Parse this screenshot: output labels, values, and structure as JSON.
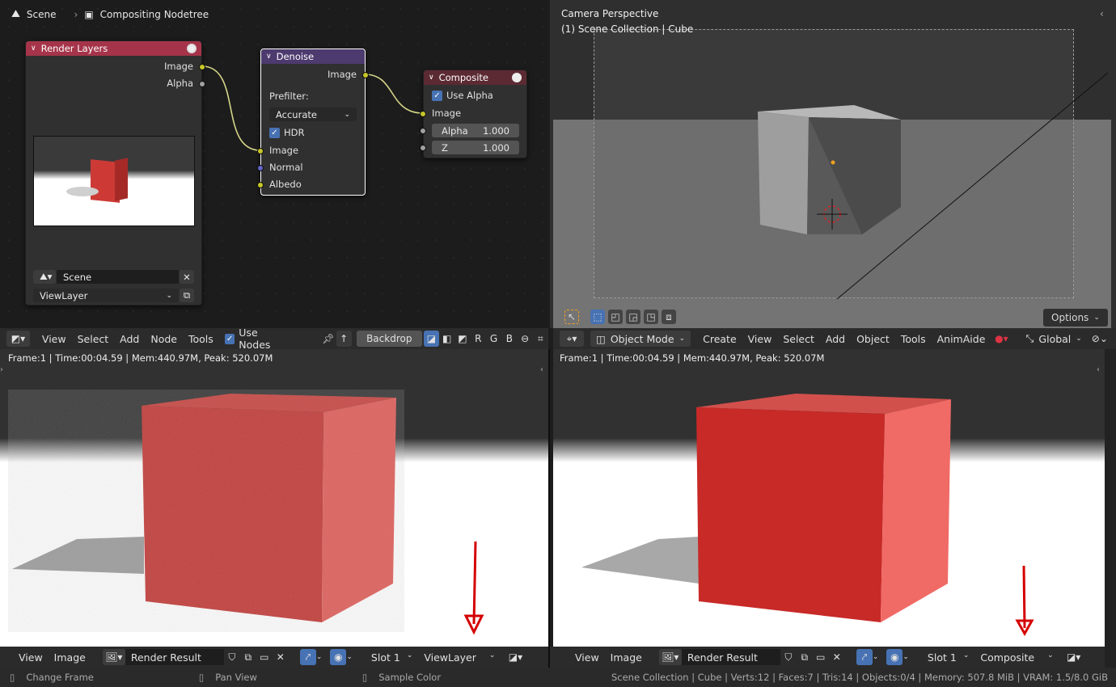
{
  "breadcrumb": {
    "scene": "Scene",
    "tree": "Compositing Nodetree"
  },
  "nodes": {
    "render_layers": {
      "title": "Render Layers",
      "out_image": "Image",
      "out_alpha": "Alpha",
      "scene": "Scene",
      "view_layer": "ViewLayer"
    },
    "denoise": {
      "title": "Denoise",
      "out_image": "Image",
      "prefilter_label": "Prefilter:",
      "prefilter_value": "Accurate",
      "hdr": "HDR",
      "in_image": "Image",
      "in_normal": "Normal",
      "in_albedo": "Albedo"
    },
    "composite": {
      "title": "Composite",
      "use_alpha": "Use Alpha",
      "in_image": "Image",
      "alpha_label": "Alpha",
      "alpha_value": "1.000",
      "z_label": "Z",
      "z_value": "1.000"
    }
  },
  "node_header": {
    "view": "View",
    "select": "Select",
    "add": "Add",
    "node": "Node",
    "tools": "Tools",
    "use_nodes": "Use Nodes",
    "backdrop": "Backdrop",
    "r": "R",
    "g": "G",
    "b": "B"
  },
  "viewport": {
    "line1": "Camera Perspective",
    "line2": "(1) Scene Collection | Cube",
    "options": "Options"
  },
  "viewport_header": {
    "mode": "Object Mode",
    "create": "Create",
    "view": "View",
    "select": "Select",
    "add": "Add",
    "object": "Object",
    "tools": "Tools",
    "animaide": "AnimAide",
    "orientation": "Global"
  },
  "render_info": "Frame:1 | Time:00:04.59 | Mem:440.97M, Peak: 520.07M",
  "image_left": {
    "view": "View",
    "image": "Image",
    "render": "Render Result",
    "slot": "Slot 1",
    "layer": "ViewLayer"
  },
  "image_right": {
    "view": "View",
    "image": "Image",
    "render": "Render Result",
    "slot": "Slot 1",
    "layer": "Composite"
  },
  "status": {
    "change_frame": "Change Frame",
    "pan_view": "Pan View",
    "sample_color": "Sample Color",
    "stats": "Scene Collection | Cube | Verts:12 | Faces:7 | Tris:14 | Objects:0/4 | Memory: 507.8 MiB | VRAM: 1.5/8.0 GiB"
  },
  "colors": {
    "render_layers_header": "#a5344a",
    "denoise_header": "#4d3a6e",
    "composite_header": "#5c2a33",
    "socket_image": "#c7c729",
    "socket_normal": "#6363c7",
    "annotation": "#d40000"
  }
}
